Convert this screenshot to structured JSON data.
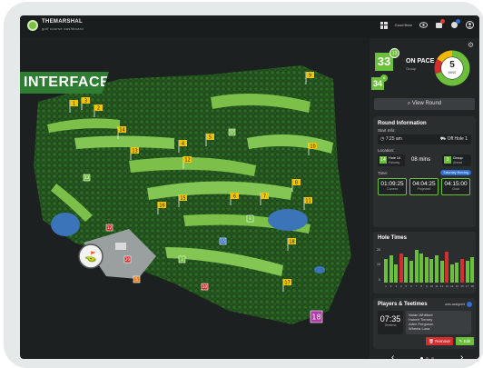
{
  "app": {
    "logo_line1": "THEMARSHAL",
    "logo_line2": "golf course dashboard"
  },
  "topbar": {
    "status_label": "Good Bear"
  },
  "tag": {
    "label": "INTERFACE"
  },
  "pace": {
    "main_number": "33",
    "main_badge": "13",
    "second_number": "34",
    "second_badge": "6",
    "status": "ON PACE",
    "sub": "Group",
    "donut_number": "5",
    "donut_label": "MINS"
  },
  "view_round": {
    "label": "View Round"
  },
  "round_info": {
    "title": "Round Information",
    "start_info_label": "Start Info:",
    "start_time": "7:25 am",
    "start_hole": "Off Hole 1",
    "location_label": "Location:",
    "hole_number": "14",
    "hole_label": "Hole 14",
    "hole_sub": "Fairway",
    "mins": "08 mins",
    "group_num": "3",
    "group_label": "Group",
    "group_sub": "Ahead",
    "time_label": "Time:",
    "time_pill": "Saturday Morning",
    "stats": [
      {
        "value": "01:09:25",
        "label": "Current"
      },
      {
        "value": "04:04:25",
        "label": "Projected"
      },
      {
        "value": "04:15:00",
        "label": "Goal"
      }
    ]
  },
  "hole_times": {
    "title": "Hole Times",
    "y_ticks": [
      "20",
      "10",
      "0"
    ],
    "x_labels": [
      "1",
      "2",
      "3",
      "4",
      "5",
      "6",
      "7",
      "8",
      "9",
      "10",
      "11",
      "12",
      "13",
      "14",
      "15",
      "16",
      "17",
      "18"
    ],
    "values": [
      13,
      15,
      10,
      16,
      14,
      12,
      18,
      16,
      14,
      13,
      15,
      12,
      17,
      10,
      11,
      13,
      12,
      14
    ],
    "colors": [
      "#6cbf3a",
      "#6cbf3a",
      "#6cbf3a",
      "#d32f2f",
      "#6cbf3a",
      "#6cbf3a",
      "#6cbf3a",
      "#6cbf3a",
      "#6cbf3a",
      "#6cbf3a",
      "#6cbf3a",
      "#6cbf3a",
      "#d32f2f",
      "#6cbf3a",
      "#6cbf3a",
      "#d32f2f",
      "#6cbf3a",
      "#6cbf3a"
    ]
  },
  "players": {
    "title": "Players & Teetimes",
    "toggle_label": "auto-assigned",
    "tee_time": "07:35",
    "tee_label": "Teetime",
    "names": [
      "Nolan Whitford",
      "Hubert Tierney",
      "Aden Ferguson",
      "Wheels Luna"
    ],
    "remove_label": "Remove",
    "edit_label": "Edit"
  },
  "nav": {
    "prev": "‹",
    "next": "›"
  },
  "map": {
    "flags": [
      "1",
      "2",
      "3",
      "4",
      "5",
      "6",
      "7",
      "8",
      "9",
      "10",
      "11",
      "12",
      "13",
      "14",
      "15",
      "16",
      "17",
      "18"
    ],
    "group_markers": [
      "18",
      "20",
      "5",
      "17",
      "8",
      "12",
      "15",
      "3",
      "10",
      "33"
    ],
    "icons": [
      "tree-icon",
      "flag-icon",
      "golfer-icon"
    ]
  },
  "colors": {
    "accent": "#6cbf3a",
    "danger": "#d32f2f",
    "info": "#2f6fd0",
    "panel": "#222526"
  }
}
